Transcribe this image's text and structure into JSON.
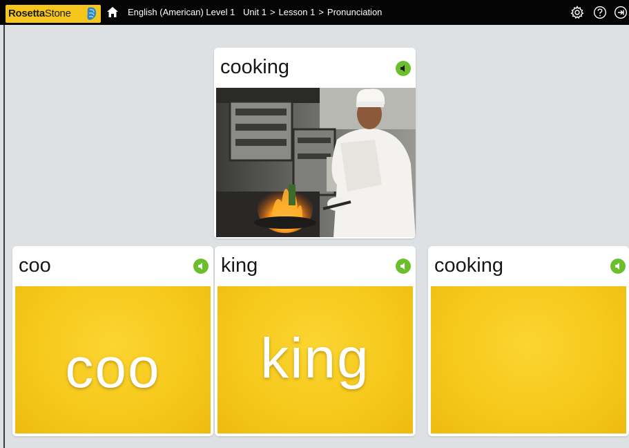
{
  "header": {
    "logo_bold": "Rosetta",
    "logo_light": "Stone",
    "course": "English (American) Level 1",
    "unit": "Unit 1",
    "lesson": "Lesson 1",
    "activity": "Pronunciation",
    "separator": ">",
    "icons": [
      "home-icon",
      "settings-gear-icon",
      "help-icon",
      "exit-icon"
    ]
  },
  "prompt_card": {
    "word": "cooking",
    "audio_icon": "speaker-icon",
    "image": "chef cooking with flaming pan in kitchen"
  },
  "syllable_cards": [
    {
      "title": "coo",
      "big_text": "coo",
      "audio_icon": "speaker-icon"
    },
    {
      "title": "king",
      "big_text": "king",
      "audio_icon": "speaker-icon"
    },
    {
      "title": "cooking",
      "big_text": "",
      "audio_icon": "speaker-icon"
    }
  ],
  "colors": {
    "accent_green": "#6cbf2c",
    "card_yellow": "#f6c91c",
    "logo_yellow": "#f4c51c",
    "topbar": "#050505",
    "background": "#dde1e4"
  }
}
